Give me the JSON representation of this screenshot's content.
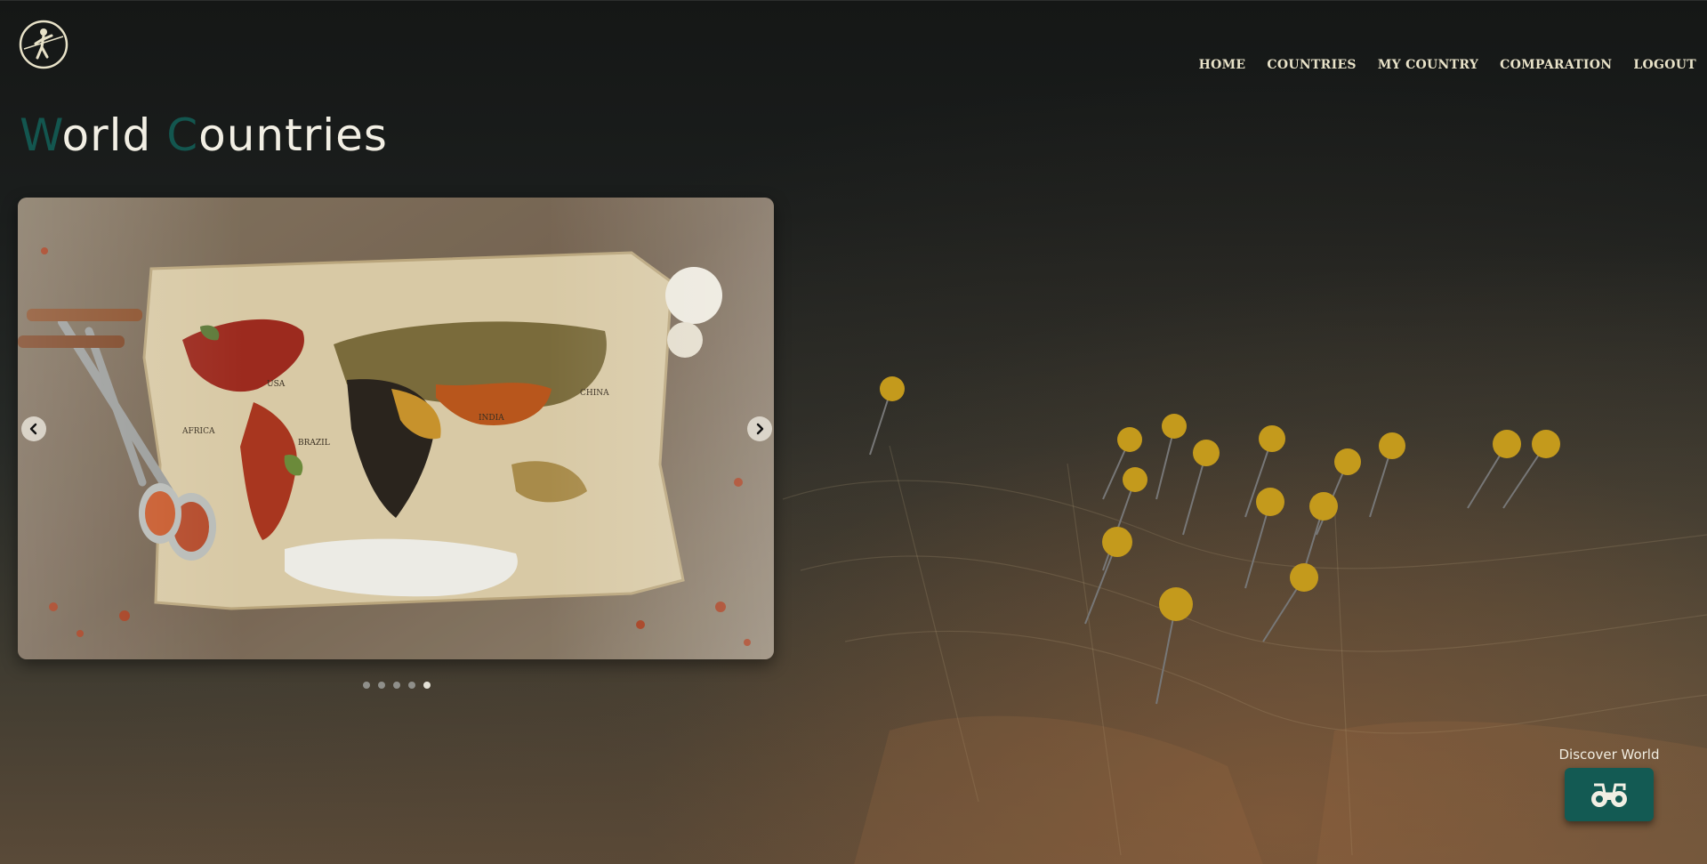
{
  "nav": {
    "items": [
      {
        "label": "HOME"
      },
      {
        "label": "COUNTRIES"
      },
      {
        "label": "MY COUNTRY"
      },
      {
        "label": "COMPARATION"
      },
      {
        "label": "LOGOUT"
      }
    ]
  },
  "header": {
    "title_first_initial": "W",
    "title_first_rest": "orld",
    "title_second_initial": "C",
    "title_second_rest": "ountries"
  },
  "carousel": {
    "slide_count": 5,
    "active_index": 4,
    "map_labels": [
      "USA",
      "BRAZIL",
      "AFRICA",
      "CHINA",
      "INDIA"
    ]
  },
  "discover": {
    "label": "Discover World",
    "icon": "binoculars-icon"
  },
  "colors": {
    "accent": "#13564f",
    "nav_text": "#e8e2c8",
    "button": "#135a53"
  },
  "icons": {
    "logo": "explorer-logo-icon",
    "prev": "chevron-left-icon",
    "next": "chevron-right-icon"
  }
}
